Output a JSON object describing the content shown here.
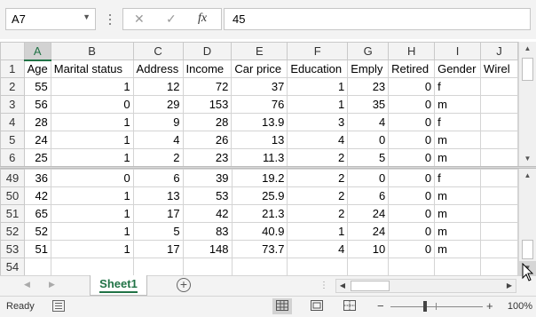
{
  "formula_bar": {
    "name_box": "A7",
    "cancel_icon": "✕",
    "enter_icon": "✓",
    "fx_icon": "fx",
    "formula_value": "45"
  },
  "columns": [
    "A",
    "B",
    "C",
    "D",
    "E",
    "F",
    "G",
    "H",
    "I",
    "J"
  ],
  "active_column": "A",
  "top_rows": [
    {
      "row": "1",
      "cells": [
        "Age",
        "Marital status",
        "Address",
        "Income",
        "Car price",
        "Education",
        "Emply",
        "Retired",
        "Gender",
        "Wirel"
      ]
    },
    {
      "row": "2",
      "cells": [
        "55",
        "1",
        "12",
        "72",
        "37",
        "1",
        "23",
        "0",
        "f",
        ""
      ]
    },
    {
      "row": "3",
      "cells": [
        "56",
        "0",
        "29",
        "153",
        "76",
        "1",
        "35",
        "0",
        "m",
        ""
      ]
    },
    {
      "row": "4",
      "cells": [
        "28",
        "1",
        "9",
        "28",
        "13.9",
        "3",
        "4",
        "0",
        "f",
        ""
      ]
    },
    {
      "row": "5",
      "cells": [
        "24",
        "1",
        "4",
        "26",
        "13",
        "4",
        "0",
        "0",
        "m",
        ""
      ]
    },
    {
      "row": "6",
      "cells": [
        "25",
        "1",
        "2",
        "23",
        "11.3",
        "2",
        "5",
        "0",
        "m",
        ""
      ]
    }
  ],
  "bottom_rows": [
    {
      "row": "49",
      "cells": [
        "36",
        "0",
        "6",
        "39",
        "19.2",
        "2",
        "0",
        "0",
        "f",
        ""
      ]
    },
    {
      "row": "50",
      "cells": [
        "42",
        "1",
        "13",
        "53",
        "25.9",
        "2",
        "6",
        "0",
        "m",
        ""
      ]
    },
    {
      "row": "51",
      "cells": [
        "65",
        "1",
        "17",
        "42",
        "21.3",
        "2",
        "24",
        "0",
        "m",
        ""
      ]
    },
    {
      "row": "52",
      "cells": [
        "52",
        "1",
        "5",
        "83",
        "40.9",
        "1",
        "24",
        "0",
        "m",
        ""
      ]
    },
    {
      "row": "53",
      "cells": [
        "51",
        "1",
        "17",
        "148",
        "73.7",
        "4",
        "10",
        "0",
        "m",
        ""
      ]
    },
    {
      "row": "54",
      "cells": [
        "",
        "",
        "",
        "",
        "",
        "",
        "",
        "",
        "",
        ""
      ]
    }
  ],
  "sheet_tabs": {
    "active": "Sheet1",
    "add_icon": "+"
  },
  "status_bar": {
    "ready": "Ready",
    "zoom_minus": "−",
    "zoom_plus": "+",
    "zoom_level": "100%",
    "zoom_fraction": 0.5
  },
  "colors": {
    "excel_green": "#217346",
    "header_bg": "#f3f3f3",
    "gridline": "#d4d4d4"
  }
}
